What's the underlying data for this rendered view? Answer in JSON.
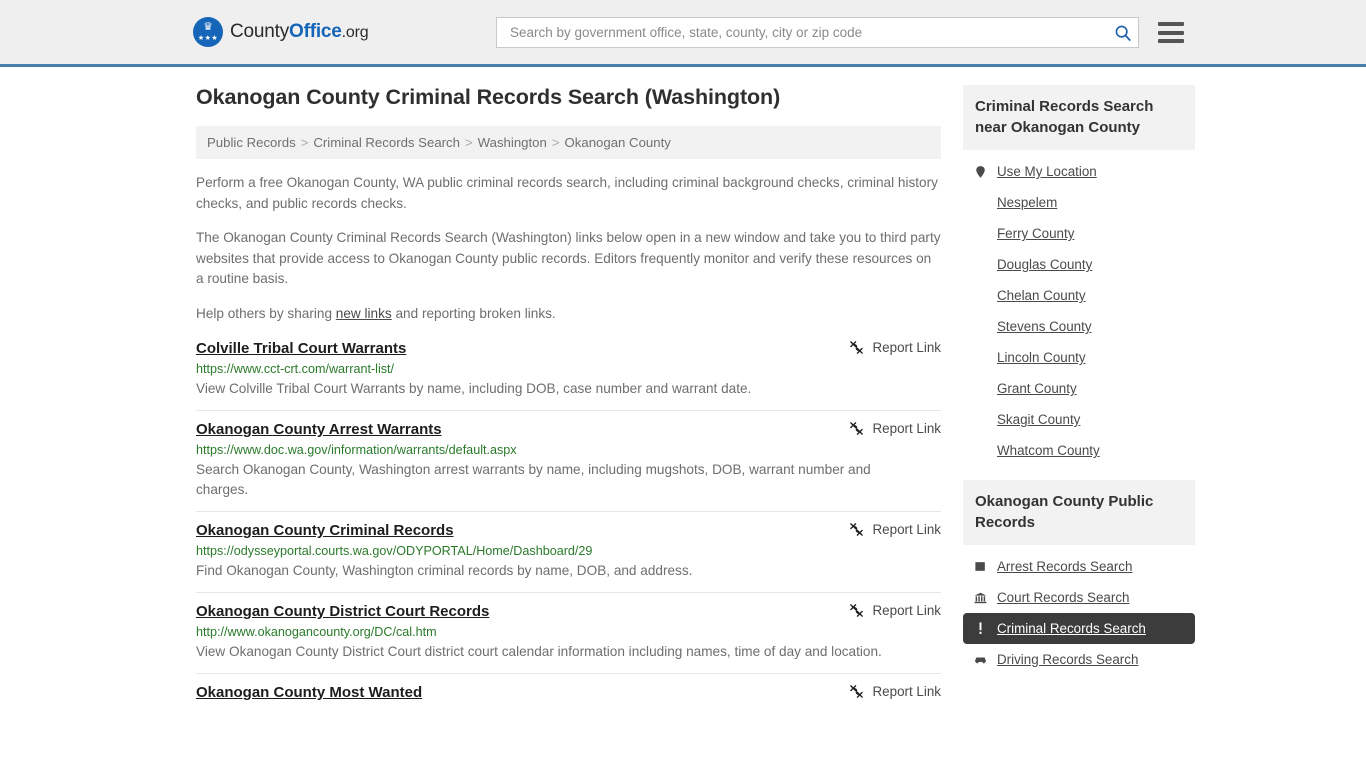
{
  "header": {
    "logo": {
      "part1": "County",
      "part2": "Office",
      "part3": ".org"
    },
    "search": {
      "placeholder": "Search by government office, state, county, city or zip code",
      "value": "",
      "icon": "search-icon"
    },
    "menu_icon": "hamburger-menu-icon",
    "accent_color": "#1565b8",
    "border_color": "#4a7fad"
  },
  "main": {
    "title": "Okanogan County Criminal Records Search (Washington)",
    "breadcrumb": [
      "Public Records",
      "Criminal Records Search",
      "Washington",
      "Okanogan County"
    ],
    "breadcrumb_separator": ">",
    "intro": {
      "p1": "Perform a free Okanogan County, WA public criminal records search, including criminal background checks, criminal history checks, and public records checks.",
      "p2": "The Okanogan County Criminal Records Search (Washington) links below open in a new window and take you to third party websites that provide access to Okanogan County public records. Editors frequently monitor and verify these resources on a routine basis.",
      "p3_before": "Help others by sharing ",
      "p3_link": "new links",
      "p3_after": " and reporting broken links."
    },
    "report_link_label": "Report Link",
    "report_link_icon": "broken-link-icon",
    "results": [
      {
        "title": "Colville Tribal Court Warrants",
        "url": "https://www.cct-crt.com/warrant-list/",
        "description": "View Colville Tribal Court Warrants by name, including DOB, case number and warrant date."
      },
      {
        "title": "Okanogan County Arrest Warrants",
        "url": "https://www.doc.wa.gov/information/warrants/default.aspx",
        "description": "Search Okanogan County, Washington arrest warrants by name, including mugshots, DOB, warrant number and charges."
      },
      {
        "title": "Okanogan County Criminal Records",
        "url": "https://odysseyportal.courts.wa.gov/ODYPORTAL/Home/Dashboard/29",
        "description": "Find Okanogan County, Washington criminal records by name, DOB, and address."
      },
      {
        "title": "Okanogan County District Court Records",
        "url": "http://www.okanogancounty.org/DC/cal.htm",
        "description": "View Okanogan County District Court district court calendar information including names, time of day and location."
      },
      {
        "title": "Okanogan County Most Wanted",
        "url": "",
        "description": ""
      }
    ]
  },
  "sidebar": {
    "nearby": {
      "heading": "Criminal Records Search near Okanogan County",
      "items": [
        {
          "label": "Use My Location",
          "icon": "map-pin-icon"
        },
        {
          "label": "Nespelem",
          "icon": ""
        },
        {
          "label": "Ferry County",
          "icon": ""
        },
        {
          "label": "Douglas County",
          "icon": ""
        },
        {
          "label": "Chelan County",
          "icon": ""
        },
        {
          "label": "Stevens County",
          "icon": ""
        },
        {
          "label": "Lincoln County",
          "icon": ""
        },
        {
          "label": "Grant County",
          "icon": ""
        },
        {
          "label": "Skagit County",
          "icon": ""
        },
        {
          "label": "Whatcom County",
          "icon": ""
        }
      ]
    },
    "public_records": {
      "heading": "Okanogan County Public Records",
      "items": [
        {
          "label": "Arrest Records Search",
          "icon": "square-icon",
          "active": false
        },
        {
          "label": "Court Records Search",
          "icon": "courthouse-icon",
          "active": false
        },
        {
          "label": "Criminal Records Search",
          "icon": "exclamation-icon",
          "active": true
        },
        {
          "label": "Driving Records Search",
          "icon": "car-icon",
          "active": false
        }
      ],
      "active_background": "#3c3c3c"
    }
  }
}
